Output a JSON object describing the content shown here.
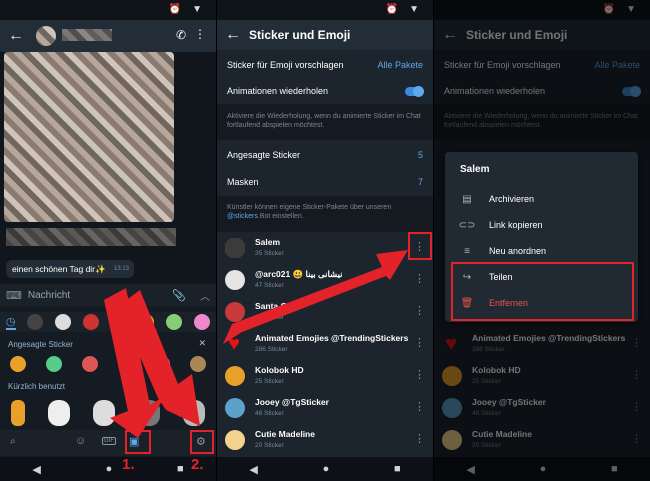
{
  "chat": {
    "composer_placeholder": "Nachricht",
    "message_text": "einen schönen Tag dir✨",
    "message_time": "13:13",
    "section_trending": "Angesagte Sticker",
    "section_recent": "Kürzlich benutzt",
    "close_glyph": "✕"
  },
  "settings": {
    "title": "Sticker und Emoji",
    "suggest_label": "Sticker für Emoji vorschlagen",
    "suggest_value": "Alle Pakete",
    "loop_label": "Animationen wiederholen",
    "loop_hint": "Aktiviere die Wiederholung, wenn du animierte Sticker im Chat fortlaufend abspielen möchtest.",
    "trending_label": "Angesagte Sticker",
    "trending_count": "5",
    "masks_label": "Masken",
    "masks_count": "7",
    "artists_hint": "Künstler können eigene Sticker-Pakete über unseren",
    "artists_link": "@stickers",
    "artists_hint2": "Bot einstellen."
  },
  "packs": [
    {
      "name": "Salem",
      "count": "35 Sticker"
    },
    {
      "name": "@arc021 😃 نیشانی بینا",
      "count": "47 Sticker"
    },
    {
      "name": "Santa Girl",
      "count": "20 Sticker"
    },
    {
      "name": "Animated Emojies @TrendingStickers",
      "count": "286 Sticker"
    },
    {
      "name": "Kolobok HD",
      "count": "25 Sticker"
    },
    {
      "name": "Jooey @TgSticker",
      "count": "48 Sticker"
    },
    {
      "name": "Cutie Madeline",
      "count": "20 Sticker"
    }
  ],
  "menu": {
    "title": "Salem",
    "items": [
      "Archivieren",
      "Link kopieren",
      "Neu anordnen",
      "Teilen",
      "Entfernen"
    ]
  },
  "annotations": {
    "step1": "1.",
    "step2": "2."
  },
  "colors": {
    "accent": "#5fa8ea",
    "red": "#e4222a",
    "danger_text": "#e5534b"
  }
}
